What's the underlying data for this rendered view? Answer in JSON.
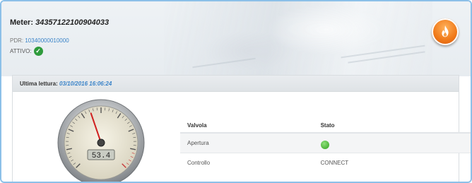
{
  "meter": {
    "label": "Meter:",
    "number": "34357122100904033"
  },
  "pdr": {
    "label": "PDR:",
    "value": "10340000010000"
  },
  "attivo": {
    "label": "ATTIVO:"
  },
  "icons": {
    "status_ok": "check-circle-icon",
    "brand": "flame-icon",
    "valve_open": "green-dot-icon"
  },
  "last_reading": {
    "label": "Ultima lettura:",
    "datetime": "03/10/2016 16:06:24"
  },
  "gauge": {
    "display_value": "53.4",
    "fraction": 0.43
  },
  "valve_table": {
    "headers": [
      "Valvola",
      "Stato"
    ],
    "rows": [
      {
        "name": "Apertura",
        "state": ""
      },
      {
        "name": "Controllo",
        "state": "CONNECT"
      }
    ]
  },
  "colors": {
    "accent_blue": "#3a83c8",
    "frame_border": "#8cc0e8",
    "ok_green": "#2e9b3c",
    "flame_orange": "#f07a1a"
  }
}
